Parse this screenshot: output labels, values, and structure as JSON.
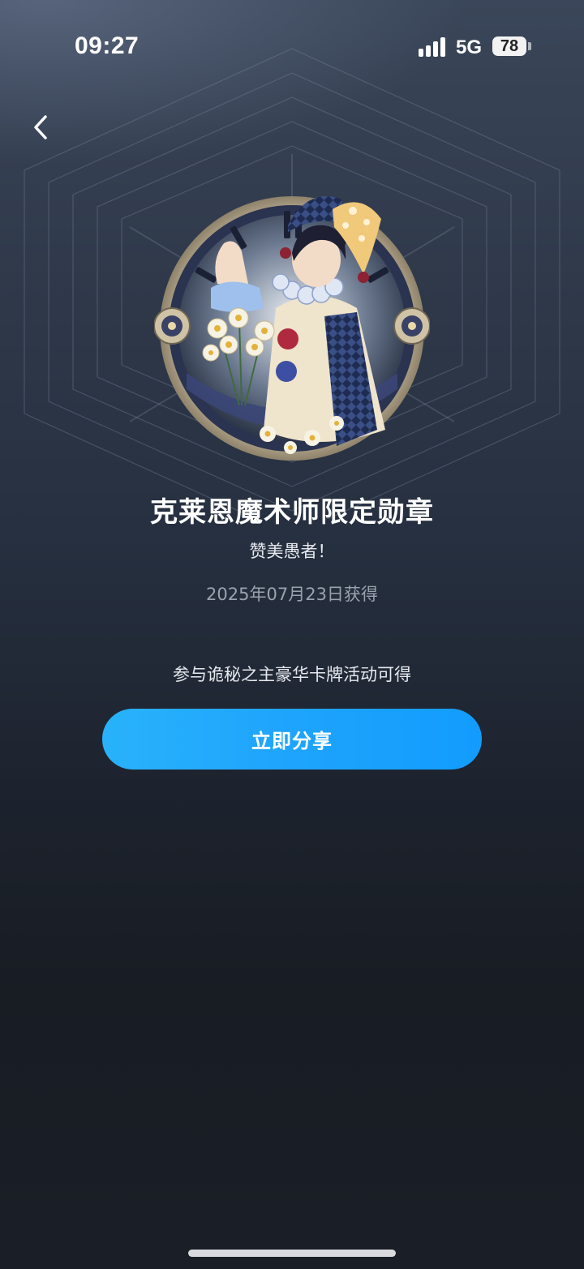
{
  "status_bar": {
    "time": "09:27",
    "network": "5G",
    "battery": "78"
  },
  "nav": {
    "back_icon": "chevron-left-icon"
  },
  "badge": {
    "image_icon": "jester-magician-badge",
    "title": "克莱恩魔术师限定勋章",
    "subtitle": "赞美愚者！",
    "earned_date": "2025年07月23日获得",
    "source": "参与诡秘之主豪华卡牌活动可得"
  },
  "actions": {
    "share_label": "立即分享"
  },
  "colors": {
    "accent": "#1ea4fc",
    "background_top": "#3a4659",
    "background_bottom": "#181c23"
  }
}
